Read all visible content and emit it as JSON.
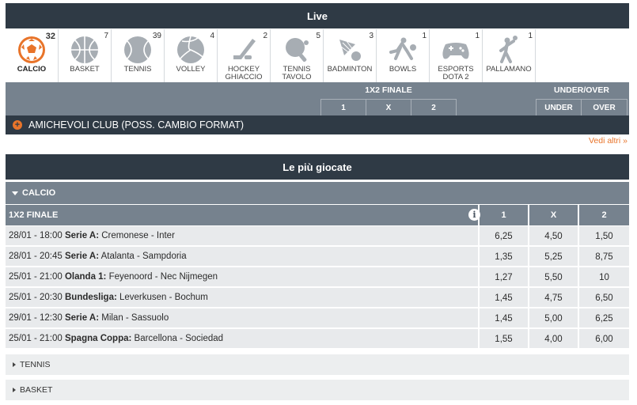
{
  "live": {
    "title": "Live",
    "sports": [
      {
        "label": "CALCIO",
        "count": "32",
        "icon": "soccer-ball-icon",
        "active": true
      },
      {
        "label": "BASKET",
        "count": "7",
        "icon": "basketball-icon"
      },
      {
        "label": "TENNIS",
        "count": "39",
        "icon": "tennis-ball-icon"
      },
      {
        "label": "VOLLEY",
        "count": "4",
        "icon": "volleyball-icon"
      },
      {
        "label": "HOCKEY GHIACCIO",
        "count": "2",
        "icon": "hockey-stick-icon"
      },
      {
        "label": "TENNIS TAVOLO",
        "count": "5",
        "icon": "ping-pong-icon"
      },
      {
        "label": "BADMINTON",
        "count": "3",
        "icon": "shuttlecock-icon"
      },
      {
        "label": "BOWLS",
        "count": "1",
        "icon": "bowls-icon"
      },
      {
        "label": "ESPORTS DOTA 2",
        "count": "1",
        "icon": "gamepad-icon"
      },
      {
        "label": "PALLAMANO",
        "count": "1",
        "icon": "handball-player-icon"
      }
    ],
    "markets": {
      "finale_title": "1X2 FINALE",
      "finale_cols": [
        "1",
        "X",
        "2"
      ],
      "uo_title": "UNDER/OVER",
      "uo_cols": [
        "UNDER",
        "OVER"
      ]
    },
    "event": "AMICHEVOLI CLUB (POSS. CAMBIO FORMAT)",
    "more_link": "Vedi altri »"
  },
  "top": {
    "title": "Le più giocate",
    "section": "CALCIO",
    "market": "1X2 FINALE",
    "info_icon": "i",
    "cols": [
      "1",
      "X",
      "2"
    ],
    "matches": [
      {
        "datetime": "28/01 - 18:00",
        "league": "Serie A:",
        "teams": "Cremonese - Inter",
        "odds": [
          "6,25",
          "4,50",
          "1,50"
        ]
      },
      {
        "datetime": "28/01 - 20:45",
        "league": "Serie A:",
        "teams": "Atalanta - Sampdoria",
        "odds": [
          "1,35",
          "5,25",
          "8,75"
        ]
      },
      {
        "datetime": "25/01 - 21:00",
        "league": "Olanda 1:",
        "teams": "Feyenoord - Nec Nijmegen",
        "odds": [
          "1,27",
          "5,50",
          "10"
        ]
      },
      {
        "datetime": "25/01 - 20:30",
        "league": "Bundesliga:",
        "teams": "Leverkusen - Bochum",
        "odds": [
          "1,45",
          "4,75",
          "6,50"
        ]
      },
      {
        "datetime": "29/01 - 12:30",
        "league": "Serie A:",
        "teams": "Milan - Sassuolo",
        "odds": [
          "1,45",
          "5,00",
          "6,25"
        ]
      },
      {
        "datetime": "25/01 - 21:00",
        "league": "Spagna Coppa:",
        "teams": "Barcellona - Sociedad",
        "odds": [
          "1,55",
          "4,00",
          "6,00"
        ]
      }
    ],
    "collapsed_sections": [
      "TENNIS",
      "BASKET"
    ]
  },
  "colors": {
    "accent": "#e8742a",
    "dark": "#2f3a45",
    "header_grey": "#76828e",
    "row_bg": "#e8eaec"
  }
}
